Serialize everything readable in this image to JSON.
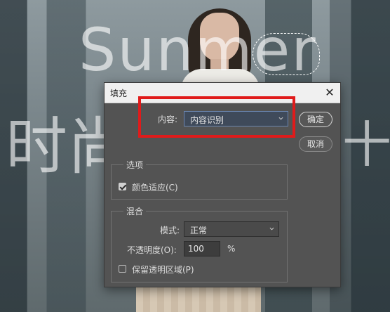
{
  "background": {
    "headline": "Sunmer",
    "subline_start": "时尚",
    "subline_end": "十"
  },
  "dialog": {
    "title": "填充",
    "close_glyph": "✕",
    "content": {
      "label": "内容:",
      "selected": "内容识别"
    },
    "buttons": {
      "ok": "确定",
      "cancel": "取消"
    },
    "options": {
      "title": "选项",
      "color_adapt_label": "颜色适应(C)",
      "color_adapt_checked": true
    },
    "blend": {
      "title": "混合",
      "mode_label": "模式:",
      "mode_value": "正常",
      "opacity_label": "不透明度(O):",
      "opacity_value": "100",
      "opacity_unit": "%",
      "preserve_label": "保留透明区域(P)",
      "preserve_checked": false
    }
  },
  "colors": {
    "dialog_bg": "#535353",
    "highlight": "#e01b1b",
    "titlebar": "#f0f0f0"
  }
}
